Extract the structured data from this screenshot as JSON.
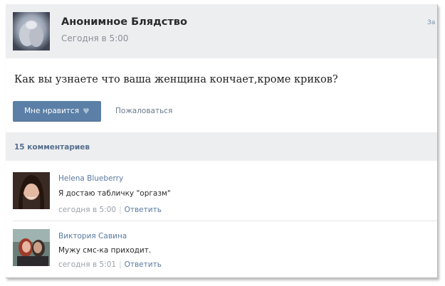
{
  "post": {
    "group_name": "Анонимное Блядство",
    "time": "Сегодня в 5:00",
    "edge_label": "За",
    "text": "Как вы узнаете что ваша женщина кончает,кроме криков?",
    "like_label": "Мне нравится",
    "heart_icon": "heart-icon",
    "report_label": "Пожаловаться"
  },
  "comments_header": {
    "count_label": "15 комментариев"
  },
  "comments": [
    {
      "author": "Helena Blueberry",
      "text": "Я достаю табличку \"оргазм\"",
      "time": "сегодня в 5:00",
      "reply": "Ответить"
    },
    {
      "author": "Виктория Савина",
      "text": "Мужу смс-ка приходит.",
      "time": "сегодня в 5:01",
      "reply": "Ответить"
    }
  ],
  "colors": {
    "header_bg": "#edeef0",
    "like_button": "#5b7fa6",
    "link": "#5a7aa0",
    "muted": "#9aa0a8"
  }
}
